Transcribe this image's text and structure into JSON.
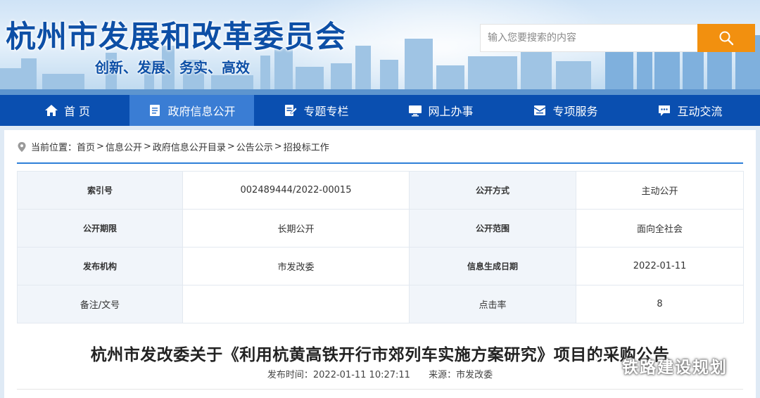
{
  "header": {
    "site_title": "杭州市发展和改革委员会",
    "slogan": "创新、发展、务实、高效",
    "search_placeholder": "输入您要搜索的内容",
    "search_icon": "search-icon",
    "colors": {
      "title": "#0d4fa6",
      "search_button": "#f2900f"
    }
  },
  "nav": {
    "bg_color": "#0a4fb0",
    "active_color": "#3a7dd4",
    "items": [
      {
        "label": "首 页",
        "icon": "home-icon"
      },
      {
        "label": "政府信息公开",
        "icon": "document-icon",
        "active": true
      },
      {
        "label": "专题专栏",
        "icon": "edit-icon"
      },
      {
        "label": "网上办事",
        "icon": "monitor-icon"
      },
      {
        "label": "专项服务",
        "icon": "envelope-icon"
      },
      {
        "label": "互动交流",
        "icon": "chat-icon"
      }
    ]
  },
  "breadcrumb": {
    "prefix": "当前位置：",
    "items": [
      "首页",
      "信息公开",
      "政府信息公开目录",
      "公告公示",
      "招投标工作"
    ],
    "separator": ">"
  },
  "meta_table": {
    "rows": [
      [
        "索引号",
        "002489444/2022-00015",
        "公开方式",
        "主动公开"
      ],
      [
        "公开期限",
        "长期公开",
        "公开范围",
        "面向全社会"
      ],
      [
        "发布机构",
        "市发改委",
        "信息生成日期",
        "2022-01-11"
      ],
      [
        "备注/文号",
        "",
        "点击率",
        "8"
      ]
    ]
  },
  "article": {
    "title": "杭州市发改委关于《利用杭黄高铁开行市郊列车实施方案研究》项目的采购公告",
    "publish_time": "发布时间：2022-01-11 10:27:11",
    "source": "来源：市发改委"
  },
  "watermark": {
    "text": "铁路建设规划",
    "icon": "wechat-icon"
  }
}
